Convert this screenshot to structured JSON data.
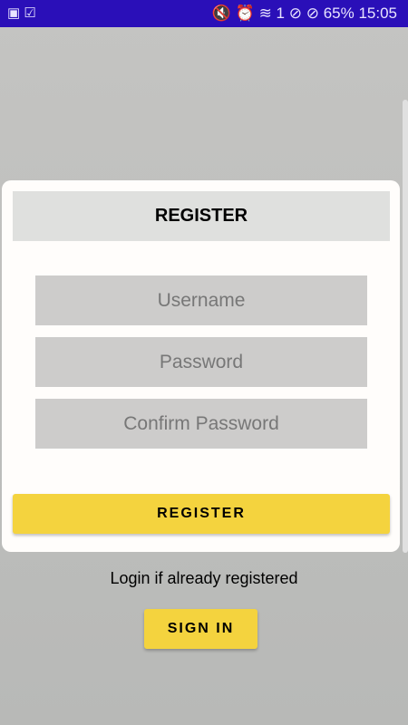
{
  "status": {
    "left_icons": "▣ ☑",
    "right_icons": "🔇 ⏰ ≋ 1 ⊘ ⊘",
    "battery": "65%",
    "time": "15:05"
  },
  "card": {
    "title": "REGISTER",
    "username_placeholder": "Username",
    "password_placeholder": "Password",
    "confirm_placeholder": "Confirm Password",
    "register_button": "REGISTER"
  },
  "login_text": "Login if already registered",
  "signin_button": "SIGN IN"
}
